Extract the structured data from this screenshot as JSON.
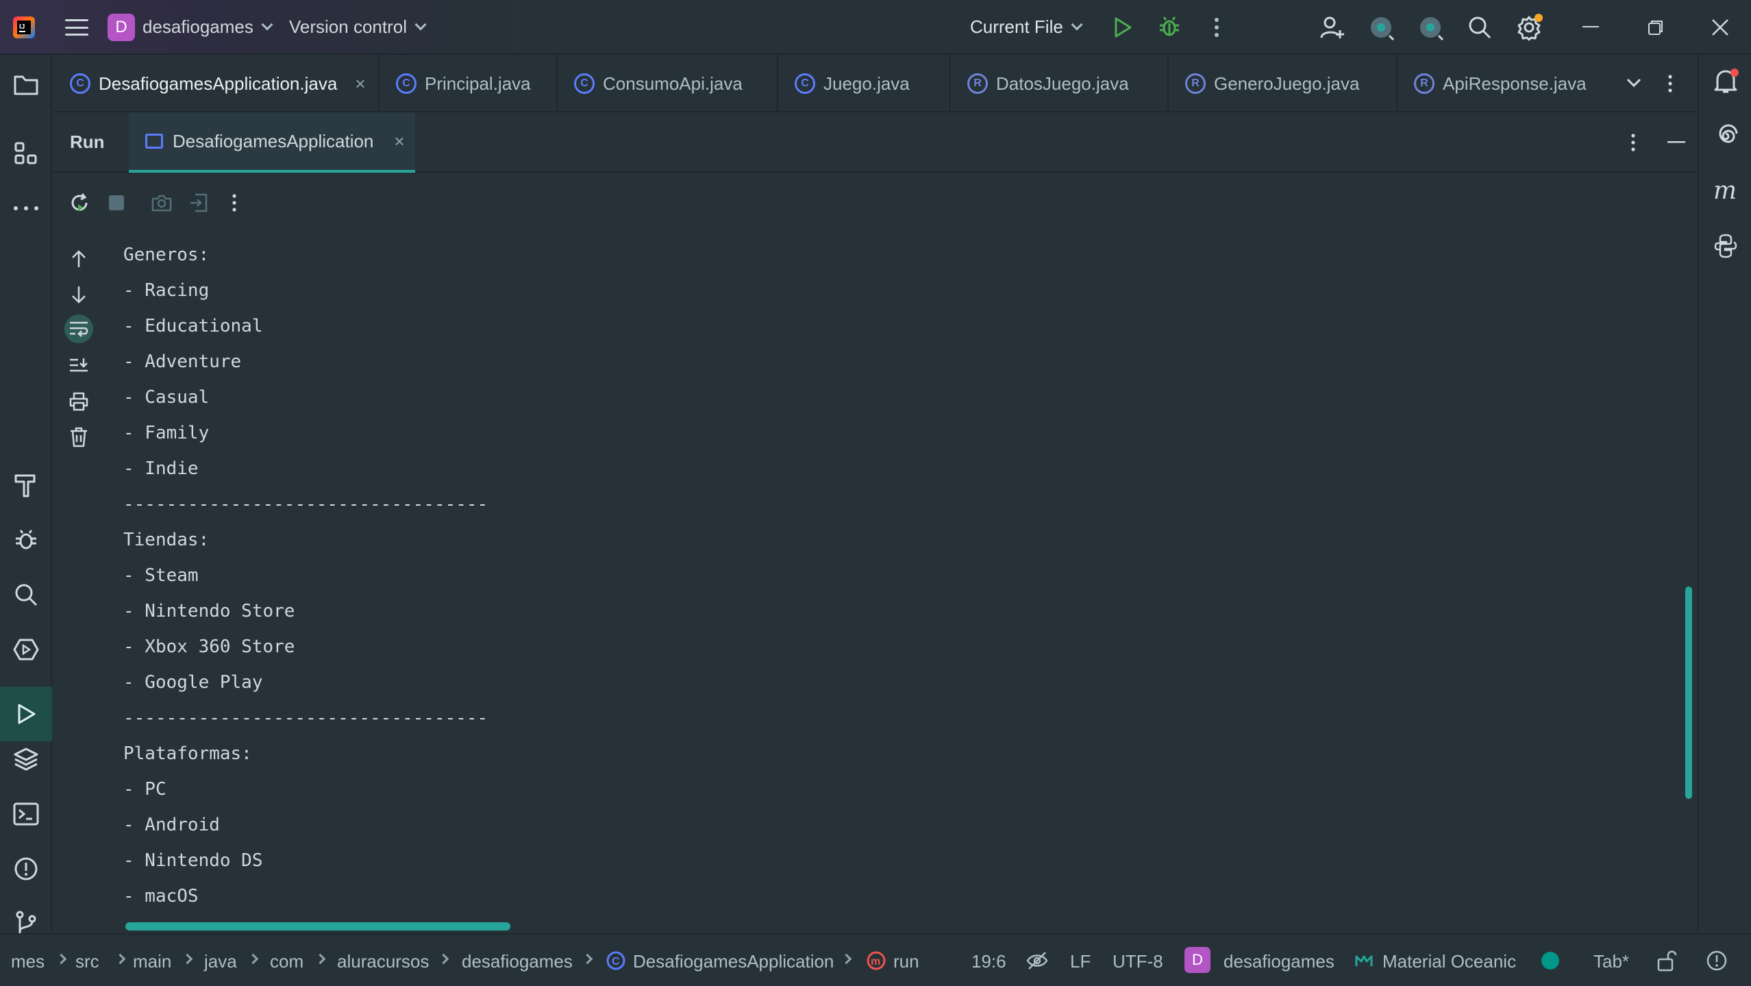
{
  "titlebar": {
    "project_initial": "D",
    "project_name": "desafiogames",
    "version_control": "Version control",
    "run_config": "Current File"
  },
  "tabs": [
    {
      "label": "DesafiogamesApplication.java",
      "icon": "class-icon",
      "active": true
    },
    {
      "label": "Principal.java",
      "icon": "class-icon"
    },
    {
      "label": "ConsumoApi.java",
      "icon": "class-icon"
    },
    {
      "label": "Juego.java",
      "icon": "class-icon"
    },
    {
      "label": "DatosJuego.java",
      "icon": "record-icon"
    },
    {
      "label": "GeneroJuego.java",
      "icon": "record-icon"
    },
    {
      "label": "ApiResponse.java",
      "icon": "record-icon"
    }
  ],
  "run_panel": {
    "label": "Run",
    "config_tab": "DesafiogamesApplication"
  },
  "console_lines": [
    "Generos:",
    "- Racing",
    "- Educational",
    "- Adventure",
    "- Casual",
    "- Family",
    "- Indie",
    "----------------------------------",
    "Tiendas:",
    "- Steam",
    "- Nintendo Store",
    "- Xbox 360 Store",
    "- Google Play",
    "----------------------------------",
    "Plataformas:",
    "- PC",
    "- Android",
    "- Nintendo DS",
    "- macOS"
  ],
  "statusbar": {
    "breadcrumbs": [
      "mes",
      "src",
      "main",
      "java",
      "com",
      "aluracursos",
      "desafiogames",
      "DesafiogamesApplication",
      "run"
    ],
    "position": "19:6",
    "line_ending": "LF",
    "encoding": "UTF-8",
    "project_initial": "D",
    "project": "desafiogames",
    "theme": "Material Oceanic",
    "indent": "Tab*"
  },
  "colors": {
    "background": "#263238",
    "accent": "#26a69a",
    "project_badge": "#b455c6",
    "run_green": "#4caf50"
  }
}
